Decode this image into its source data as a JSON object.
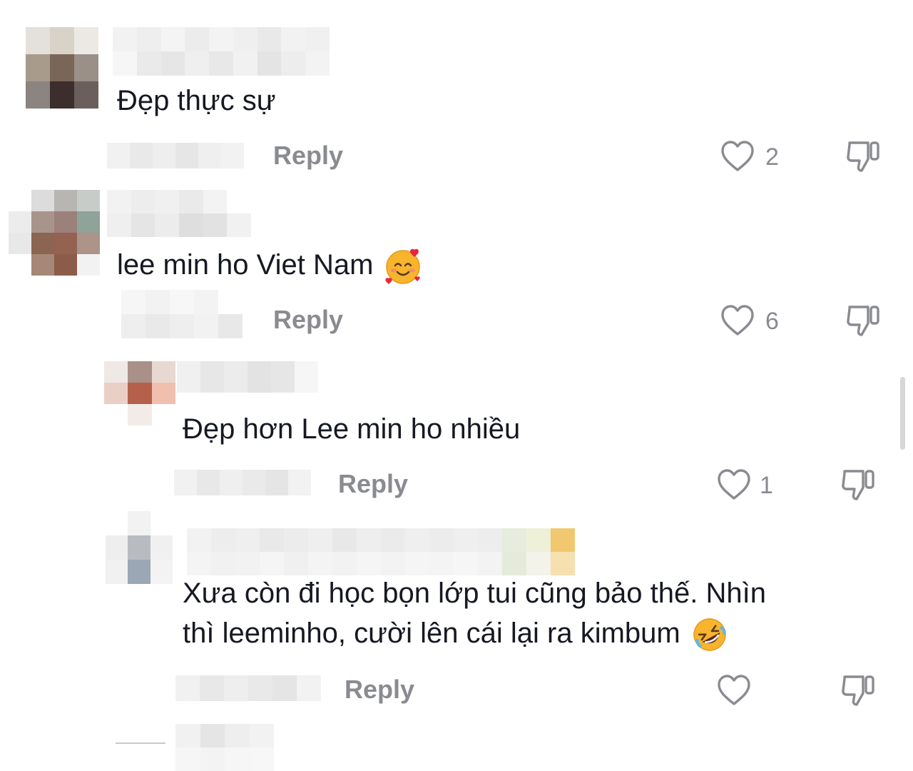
{
  "comments": [
    {
      "text": "Đẹp thực sự",
      "reply_label": "Reply",
      "like_count": "2"
    },
    {
      "text": "lee min ho Viet Nam",
      "emoji": "smiling-face-with-hearts",
      "reply_label": "Reply",
      "like_count": "6"
    },
    {
      "text": "Đẹp hơn Lee min ho nhiều",
      "reply_label": "Reply",
      "like_count": "1"
    },
    {
      "text_line1": "Xưa còn đi học bọn lớp tui cũng bảo thế. Nhìn",
      "text_line2": "thì leeminho, cười lên cái lại ra kimbum",
      "emoji": "rolling-on-floor-laughing",
      "reply_label": "Reply",
      "like_count": ""
    }
  ],
  "icons": {
    "like": "heart-outline-icon",
    "dislike": "thumbs-down-outline-icon"
  },
  "colors": {
    "text": "#161823",
    "muted": "#8a8b91",
    "background": "#ffffff"
  }
}
